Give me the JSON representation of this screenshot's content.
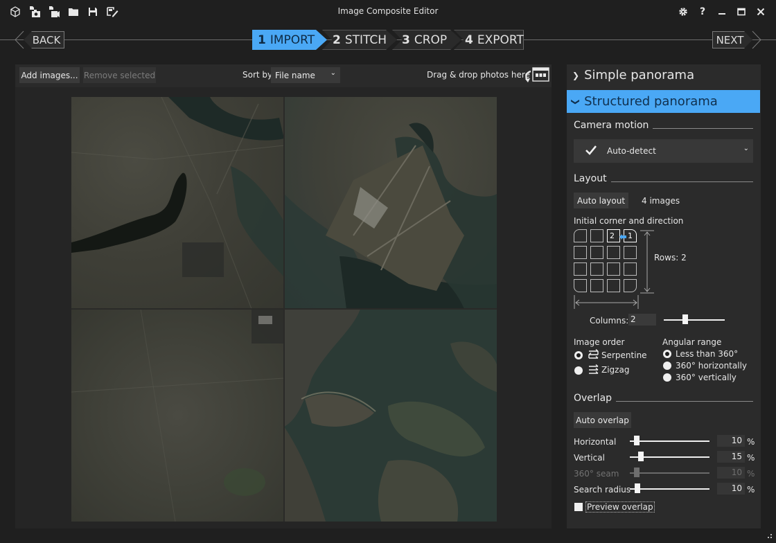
{
  "window": {
    "title": "Image Composite Editor",
    "toolbar_icons": [
      "new-project-icon",
      "import-photos-icon",
      "import-video-icon",
      "open-folder-icon",
      "save-icon",
      "export-edit-icon"
    ],
    "controls": [
      "settings-icon",
      "help-icon",
      "minimize-icon",
      "maximize-icon",
      "close-icon"
    ],
    "help_glyph": "?"
  },
  "nav": {
    "back_label": "BACK",
    "next_label": "NEXT",
    "steps": [
      {
        "num": "1",
        "label": "IMPORT",
        "active": true
      },
      {
        "num": "2",
        "label": "STITCH",
        "active": false
      },
      {
        "num": "3",
        "label": "CROP",
        "active": false
      },
      {
        "num": "4",
        "label": "EXPORT",
        "active": false
      }
    ]
  },
  "import_toolbar": {
    "add_images": "Add images...",
    "remove_selected": "Remove selected",
    "sort_by_label": "Sort by",
    "sort_by_value": "File name",
    "drop_hint": "Drag & drop photos here"
  },
  "canvas": {
    "image_count": 4,
    "rows": 2,
    "columns": 2
  },
  "panel": {
    "simple_panorama": "Simple panorama",
    "structured_panorama": "Structured panorama",
    "camera_motion": {
      "heading": "Camera motion",
      "value": "Auto-detect"
    },
    "layout": {
      "heading": "Layout",
      "auto_layout": "Auto layout",
      "image_count": "4 images",
      "corner_label": "Initial corner and direction",
      "grid_labels": {
        "first": "1",
        "second": "2"
      },
      "rows_label": "Rows:",
      "rows_value": "2",
      "columns_label": "Columns:",
      "columns_value": "2",
      "columns_slider_fraction": 0.35
    },
    "image_order": {
      "heading": "Image order",
      "options": [
        {
          "label": "Serpentine",
          "selected": true
        },
        {
          "label": "Zigzag",
          "selected": false
        }
      ]
    },
    "angular_range": {
      "heading": "Angular range",
      "options": [
        {
          "label": "Less than 360°",
          "selected": true
        },
        {
          "label": "360° horizontally",
          "selected": false
        },
        {
          "label": "360° vertically",
          "selected": false
        }
      ]
    },
    "overlap": {
      "heading": "Overlap",
      "auto_overlap": "Auto overlap",
      "sliders": [
        {
          "label": "Horizontal",
          "value": "10",
          "unit": "%",
          "enabled": true
        },
        {
          "label": "Vertical",
          "value": "15",
          "unit": "%",
          "enabled": true
        },
        {
          "label": "360° seam",
          "value": "10",
          "unit": "%",
          "enabled": false
        },
        {
          "label": "Search radius",
          "value": "10",
          "unit": "%",
          "enabled": true
        }
      ],
      "preview_overlap": "Preview overlap",
      "preview_checked": false
    }
  },
  "colors": {
    "accent": "#4aa8f5",
    "background": "#1f1f1f",
    "panel": "#2b2b2b"
  }
}
